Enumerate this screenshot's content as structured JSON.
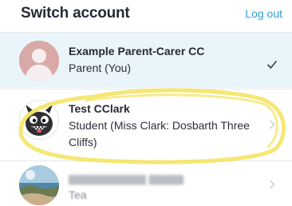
{
  "header": {
    "title": "Switch account",
    "logout_label": "Log out"
  },
  "accounts": [
    {
      "name": "Example Parent-Carer CC",
      "role": "Parent (You)",
      "avatar_icon": "person-silhouette-icon",
      "selected": true,
      "trailing_icon": "checkmark-icon"
    },
    {
      "name": "Test CClark",
      "role": "Student (Miss Clark: Dosbarth Three Cliffs)",
      "avatar_icon": "monster-avatar-icon",
      "selected": false,
      "trailing_icon": "chevron-right-icon"
    },
    {
      "name": "",
      "role": "Tea",
      "avatar_icon": "coastline-photo-icon",
      "selected": false,
      "trailing_icon": "chevron-right-icon"
    }
  ],
  "colors": {
    "accent": "#2e9ed8",
    "selected_row_bg": "#eaf5fb",
    "highlighter": "#f3e35a",
    "text": "#262a35"
  }
}
